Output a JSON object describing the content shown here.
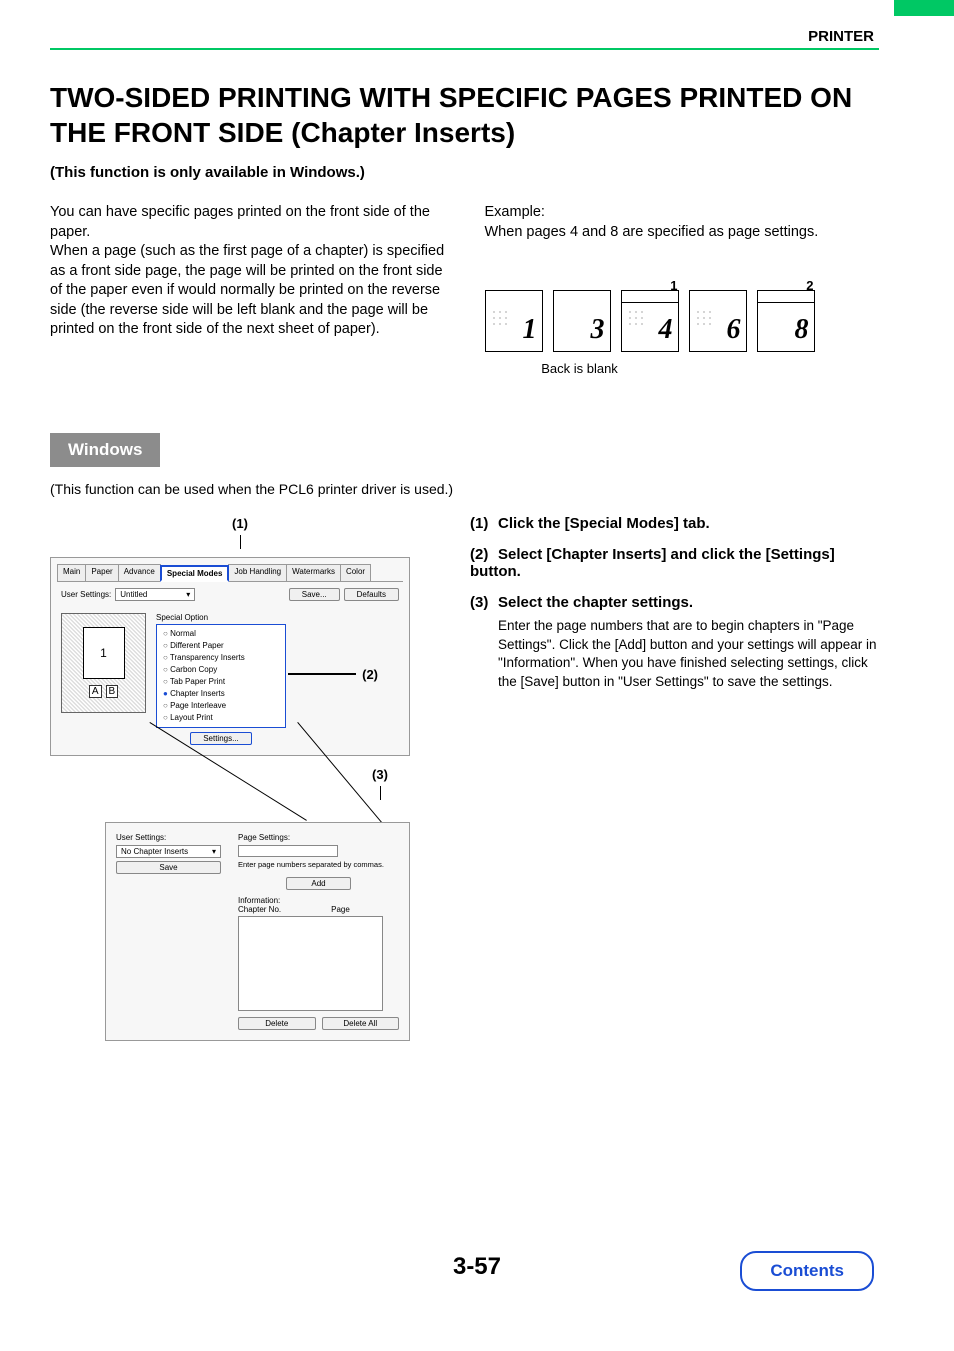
{
  "header": {
    "section": "PRINTER"
  },
  "title": "TWO-SIDED PRINTING WITH SPECIFIC PAGES PRINTED ON THE FRONT SIDE (Chapter Inserts)",
  "subtitle": "(This function is only available in Windows.)",
  "intro_left": "You can have specific pages printed on the front side of the paper.\nWhen a page (such as the first page of a chapter) is specified as a front side page, the page will be printed on the front side of the paper even if would normally be printed on the reverse side (the reverse side will be left blank and the page will be printed on the front side of the next sheet of paper).",
  "example": {
    "label": "Example:",
    "desc": "When pages 4 and 8 are specified as page settings.",
    "pages": [
      "1",
      "3",
      "4",
      "6",
      "8"
    ],
    "smalls": {
      "2": "1",
      "4": "2"
    },
    "back_blank": "Back is blank"
  },
  "windows": {
    "heading": "Windows",
    "note": "(This function can be used when the PCL6 printer driver is used.)"
  },
  "callouts": {
    "c1": "(1)",
    "c2": "(2)",
    "c3": "(3)"
  },
  "shot1": {
    "tabs": [
      "Main",
      "Paper",
      "Advance",
      "Special Modes",
      "Job Handling",
      "Watermarks",
      "Color"
    ],
    "active_tab_index": 3,
    "user_settings_label": "User Settings:",
    "user_settings_value": "Untitled",
    "save_btn": "Save...",
    "defaults_btn": "Defaults",
    "group_label": "Special Option",
    "radios": [
      "Normal",
      "Different Paper",
      "Transparency Inserts",
      "Carbon Copy",
      "Tab Paper Print",
      "Chapter Inserts",
      "Page Interleave",
      "Layout Print"
    ],
    "selected_radio_index": 5,
    "settings_btn": "Settings...",
    "preview_page_num": "1",
    "preview_a": "A",
    "preview_b": "B"
  },
  "shot2": {
    "user_settings_label": "User Settings:",
    "dropdown_value": "No Chapter Inserts",
    "save_btn": "Save",
    "page_settings_label": "Page Settings:",
    "hint": "Enter page numbers separated by commas.",
    "add_btn": "Add",
    "info_label": "Information:",
    "col1": "Chapter No.",
    "col2": "Page",
    "delete_btn": "Delete",
    "delete_all_btn": "Delete All"
  },
  "steps": [
    {
      "num": "(1)",
      "head": "Click the [Special Modes] tab."
    },
    {
      "num": "(2)",
      "head": "Select [Chapter Inserts] and click the [Settings] button."
    },
    {
      "num": "(3)",
      "head": "Select the chapter settings.",
      "body": "Enter the page numbers that are to begin chapters in \"Page Settings\". Click the [Add] button and your settings will appear in \"Information\". When you have finished selecting settings, click the [Save] button in \"User Settings\" to save the settings."
    }
  ],
  "page_number": "3-57",
  "contents_btn": "Contents"
}
